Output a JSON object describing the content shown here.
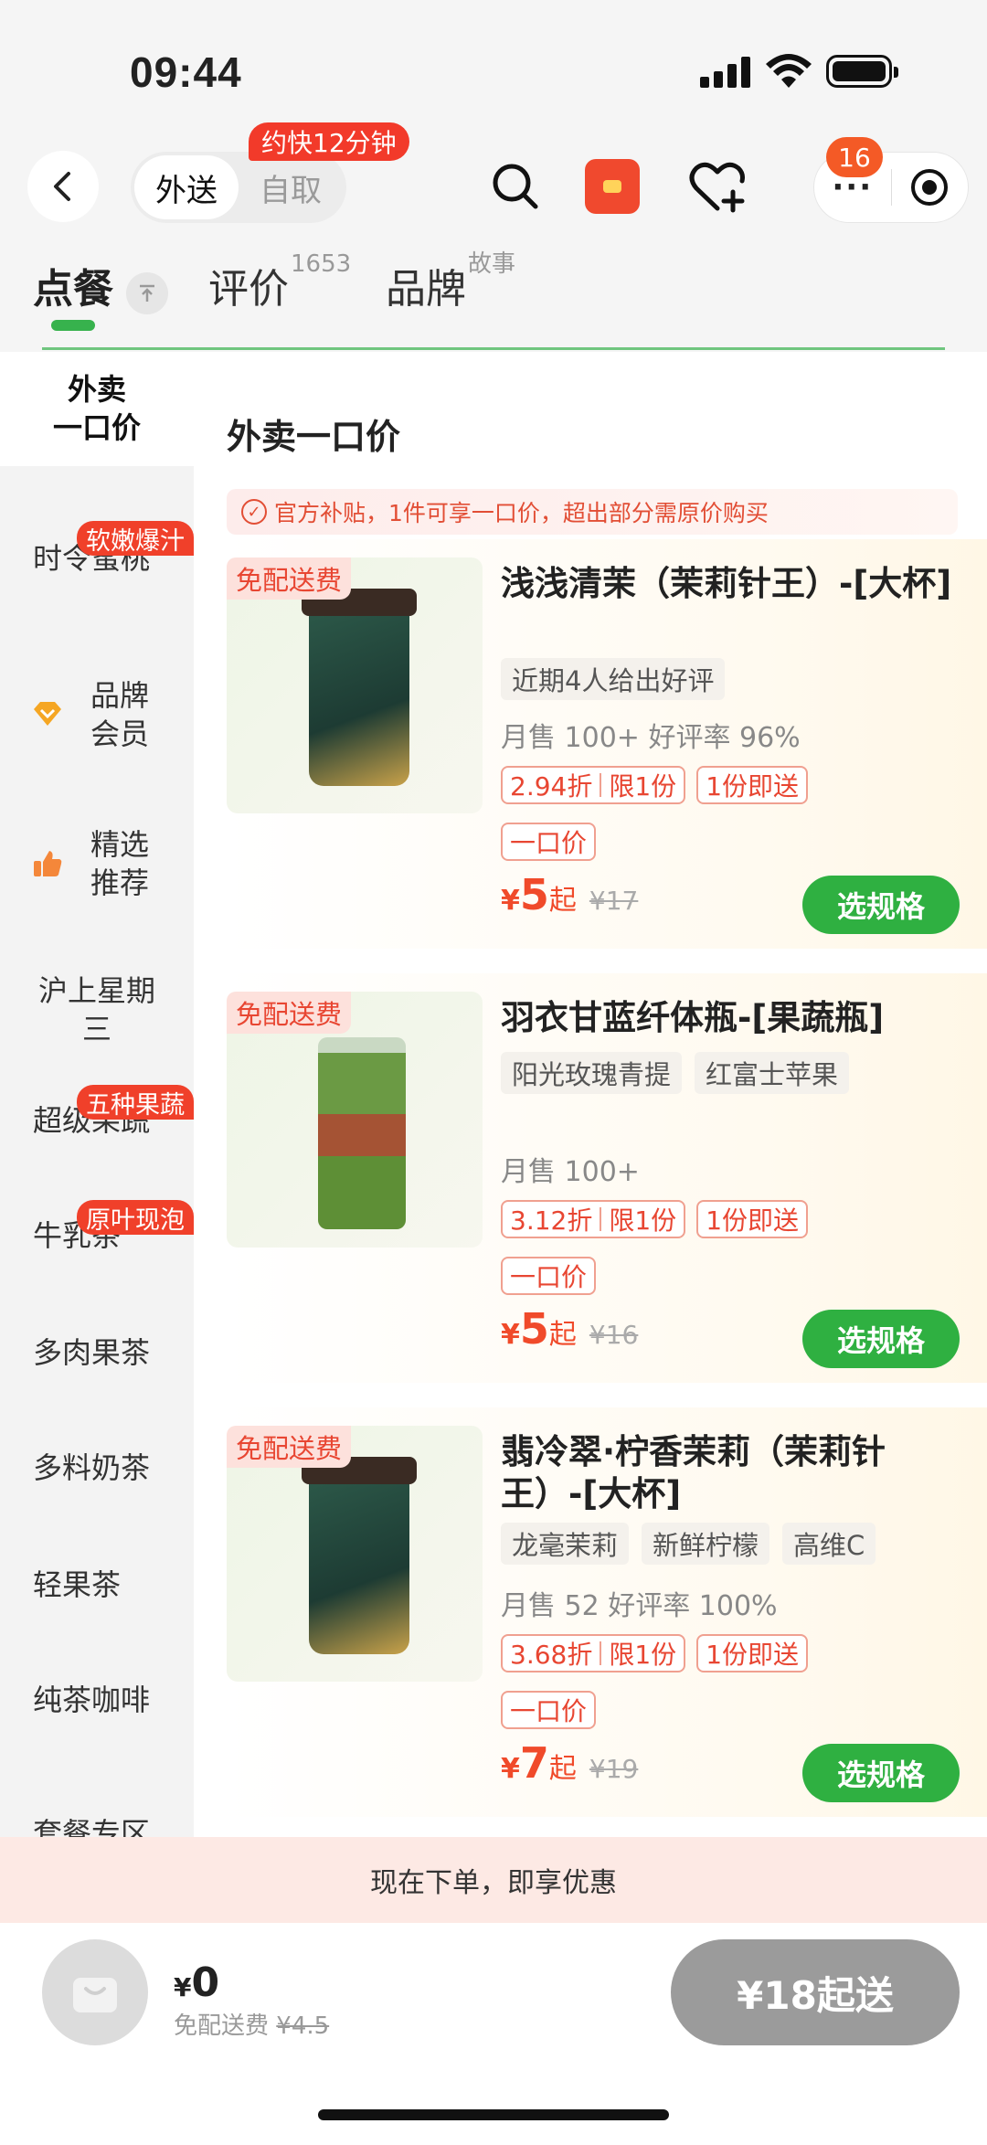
{
  "status": {
    "time": "09:44"
  },
  "nav": {
    "mode_delivery": "外送",
    "mode_pickup": "自取",
    "eta_badge": "约快12分钟",
    "message_count": "16",
    "more": "···"
  },
  "tabs": {
    "order": "点餐",
    "reviews": "评价",
    "reviews_count": "1653",
    "brand": "品牌",
    "brand_sup": "故事",
    "pin": "不"
  },
  "sidebar": {
    "items": [
      {
        "label_line1": "外卖",
        "label_line2": "一口价"
      },
      {
        "label": "时令蜜桃",
        "badge": "软嫩爆汁"
      },
      {
        "label_line1": "品牌",
        "label_line2": "会员",
        "icon": "diamond-icon"
      },
      {
        "label_line1": "精选",
        "label_line2": "推荐",
        "icon": "thumbs-up-icon"
      },
      {
        "label_line1": "沪上星期",
        "label_line2": "三"
      },
      {
        "label": "超级果蔬",
        "badge": "五种果蔬"
      },
      {
        "label": "牛乳茶",
        "badge": "原叶现泡"
      },
      {
        "label": "多肉果茶"
      },
      {
        "label": "多料奶茶"
      },
      {
        "label": "轻果茶"
      },
      {
        "label": "纯茶咖啡"
      },
      {
        "label": "套餐专区"
      }
    ]
  },
  "section": {
    "title": "外卖一口价",
    "notice": "官方补贴，1件可享一口价，超出部分需原价购买"
  },
  "products": [
    {
      "free_tag": "免配送费",
      "name": "浅浅清茉（茉莉针王）-[大杯]",
      "chips": [
        "近期4人给出好评"
      ],
      "sales": "月售 100+ 好评率 96%",
      "discount": "2.94折",
      "limit": "限1份",
      "deliver": "1份即送",
      "fixed": "一口价",
      "currency": "¥",
      "price": "5",
      "price_suffix": "起",
      "orig": "¥17",
      "button": "选规格"
    },
    {
      "free_tag": "免配送费",
      "name": "羽衣甘蓝纤体瓶-[果蔬瓶]",
      "chips": [
        "阳光玫瑰青提",
        "红富士苹果"
      ],
      "sales": "月售 100+",
      "discount": "3.12折",
      "limit": "限1份",
      "deliver": "1份即送",
      "fixed": "一口价",
      "currency": "¥",
      "price": "5",
      "price_suffix": "起",
      "orig": "¥16",
      "button": "选规格"
    },
    {
      "free_tag": "免配送费",
      "name": "翡冷翠·柠香茉莉（茉莉针王）-[大杯]",
      "chips": [
        "龙毫茉莉",
        "新鲜柠檬",
        "高维C"
      ],
      "sales": "月售 52 好评率 100%",
      "discount": "3.68折",
      "limit": "限1份",
      "deliver": "1份即送",
      "fixed": "一口价",
      "currency": "¥",
      "price": "7",
      "price_suffix": "起",
      "orig": "¥19",
      "button": "选规格"
    }
  ],
  "promo_strip": "现在下单，即享优惠",
  "cart": {
    "currency": "¥",
    "total": "0",
    "fee_label": "免配送费",
    "fee_orig": "¥4.5",
    "checkout": "¥18起送"
  },
  "colors": {
    "accent_green": "#2fb041",
    "price_red": "#f04a2a",
    "badge_red": "#f0402a"
  }
}
